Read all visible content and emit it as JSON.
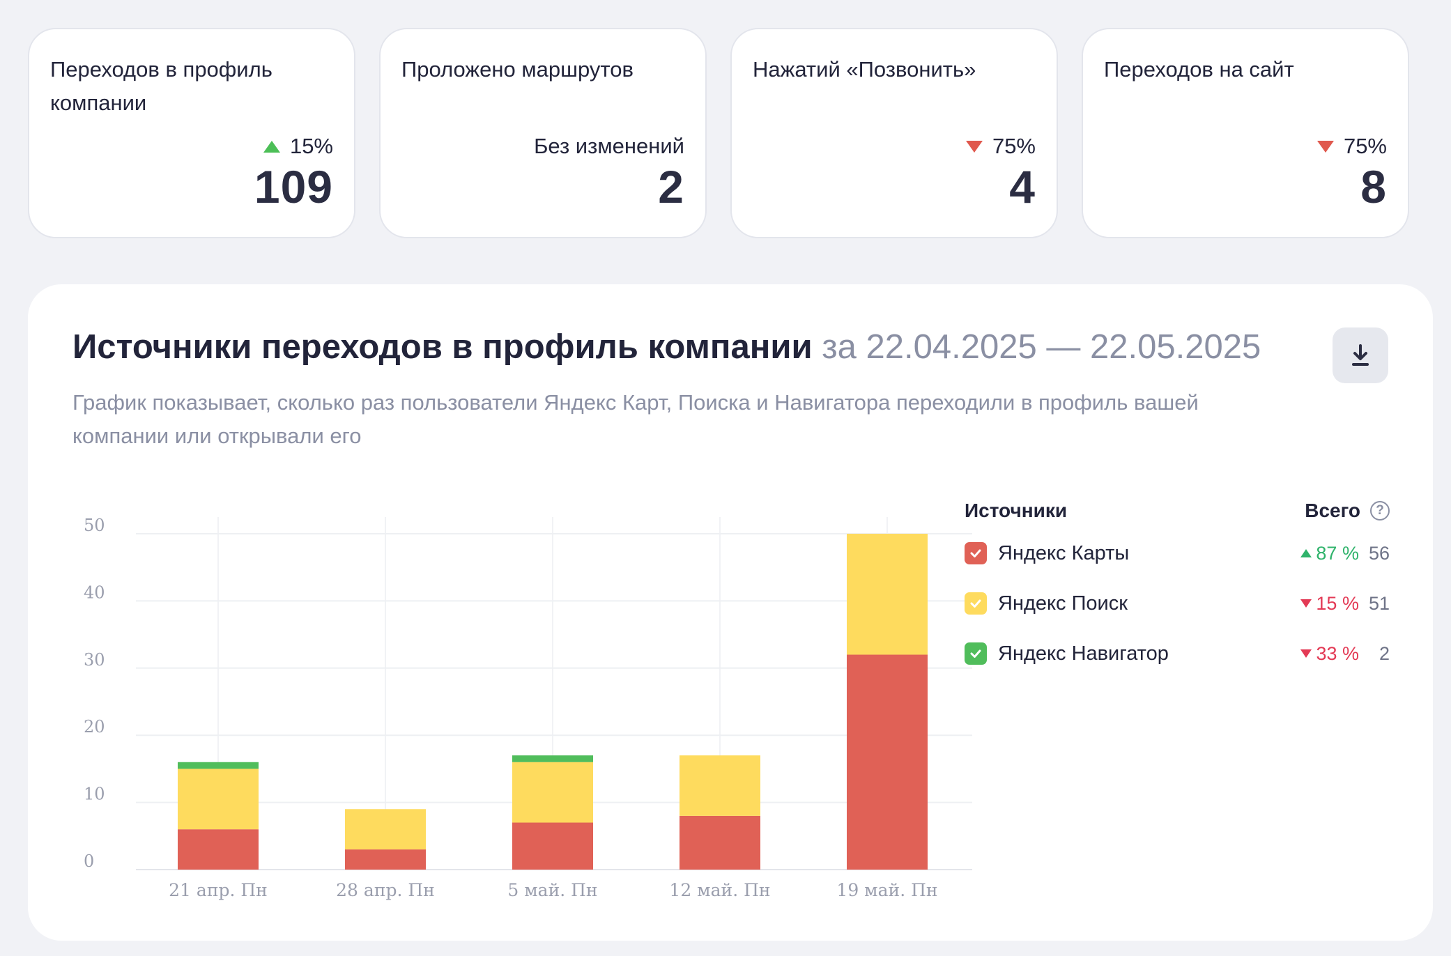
{
  "kpis": [
    {
      "title": "Переходов в профиль компании",
      "change": "15%",
      "direction": "up",
      "value": "109"
    },
    {
      "title": "Проложено маршрутов",
      "change": "Без изменений",
      "direction": "none",
      "value": "2"
    },
    {
      "title": "Нажатий «Позвонить»",
      "change": "75%",
      "direction": "down",
      "value": "4"
    },
    {
      "title": "Переходов на сайт",
      "change": "75%",
      "direction": "down",
      "value": "8"
    }
  ],
  "panel": {
    "title": "Источники переходов в профиль компании",
    "period": "за 22.04.2025 — 22.05.2025",
    "description": "График показывает, сколько раз пользователи Яндекс Карт, Поиска и Навигатора переходили в профиль вашей компании или открывали его",
    "download_icon": "download-icon"
  },
  "legend": {
    "sources_label": "Источники",
    "total_label": "Всего",
    "help_glyph": "?",
    "items": [
      {
        "name": "Яндекс Карты",
        "color": "#e06156",
        "change": "87 %",
        "direction": "up",
        "change_color": "#2fb36b",
        "total": "56"
      },
      {
        "name": "Яндекс Поиск",
        "color": "#fedb5e",
        "change": "15 %",
        "direction": "down",
        "change_color": "#e33a55",
        "total": "51"
      },
      {
        "name": "Яндекс Навигатор",
        "color": "#50bd5b",
        "change": "33 %",
        "direction": "down",
        "change_color": "#e33a55",
        "total": "2"
      }
    ]
  },
  "chart_data": {
    "type": "bar",
    "stacked": true,
    "categories": [
      "21 апр. Пн",
      "28 апр. Пн",
      "5 май. Пн",
      "12 май. Пн",
      "19 май. Пн"
    ],
    "series": [
      {
        "name": "Яндекс Карты",
        "color": "#e06156",
        "values": [
          6,
          3,
          7,
          8,
          32
        ]
      },
      {
        "name": "Яндекс Поиск",
        "color": "#fedb5e",
        "values": [
          9,
          6,
          9,
          9,
          18
        ]
      },
      {
        "name": "Яндекс Навигатор",
        "color": "#50bd5b",
        "values": [
          1,
          0,
          1,
          0,
          0
        ]
      }
    ],
    "yticks": [
      0,
      10,
      20,
      30,
      40,
      50
    ],
    "ylim": [
      0,
      50
    ],
    "grid": true,
    "legend": "right"
  }
}
